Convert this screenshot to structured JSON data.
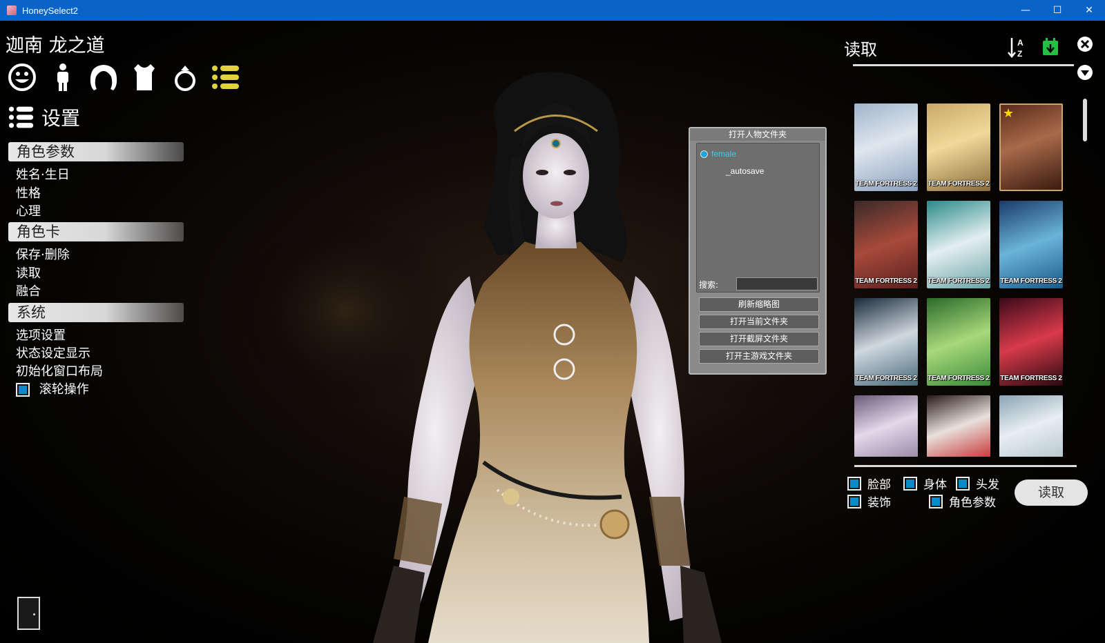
{
  "window": {
    "title": "HoneySelect2",
    "controls": {
      "minimize": "—",
      "maximize": "☐",
      "close": "✕"
    }
  },
  "left_panel": {
    "character_name": "迦南 龙之道",
    "category_icons": [
      "face-icon",
      "body-icon",
      "hair-icon",
      "clothes-icon",
      "accessory-ring-icon",
      "settings-list-icon"
    ],
    "section_title": "设置",
    "groups": [
      {
        "label": "角色参数",
        "items": [
          "姓名·生日",
          "性格",
          "心理"
        ]
      },
      {
        "label": "角色卡",
        "items": [
          "保存·删除",
          "读取",
          "融合"
        ]
      },
      {
        "label": "系统",
        "items": [
          "选项设置",
          "状态设定显示",
          "初始化窗口布局"
        ]
      }
    ],
    "scroll_option": {
      "label": "滚轮操作",
      "checked": true
    }
  },
  "folder_popup": {
    "title": "打开人物文件夹",
    "tree": {
      "root": "female",
      "child": "_autosave"
    },
    "search_label": "搜索:",
    "search_value": "",
    "buttons": [
      "刷新缩略图",
      "打开当前文件夹",
      "打开截屏文件夹",
      "打开主游戏文件夹"
    ]
  },
  "right_panel": {
    "title": "读取",
    "thumbnail_badge": "TEAM FORTRESS 2",
    "filters": [
      {
        "label": "脸部",
        "checked": true
      },
      {
        "label": "身体",
        "checked": true
      },
      {
        "label": "头发",
        "checked": true
      },
      {
        "label": "装饰",
        "checked": true
      },
      {
        "label": "角色参数",
        "checked": true
      }
    ],
    "load_button": "读取"
  },
  "colors": {
    "title_bar": "#0a64c8",
    "checkbox": "#0a8ac8",
    "accent_yellow": "#e0d23c",
    "accent_green": "#22c040"
  }
}
